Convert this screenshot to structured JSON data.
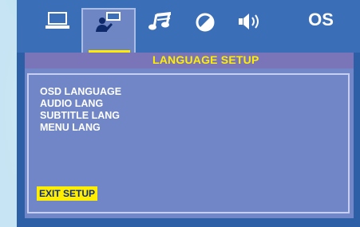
{
  "tabs": [
    {
      "icon": "laptop-icon",
      "label": ""
    },
    {
      "icon": "language-person-icon",
      "label": ""
    },
    {
      "icon": "music-note-icon",
      "label": ""
    },
    {
      "icon": "half-circle-icon",
      "label": ""
    },
    {
      "icon": "speaker-icon",
      "label": ""
    },
    {
      "icon": "os-text-icon",
      "label": "OS"
    }
  ],
  "selected_tab": 1,
  "title": "LANGUAGE  SETUP",
  "menu": {
    "items": [
      "OSD LANGUAGE",
      "AUDIO LANG",
      "SUBTITLE LANG",
      "MENU LANG"
    ]
  },
  "exit_label": "EXIT SETUP",
  "colors": {
    "accent_yellow": "#ffee00",
    "panel": "#7187c7",
    "title_bar": "#7a74b9",
    "screen": "#2d5fa6"
  }
}
